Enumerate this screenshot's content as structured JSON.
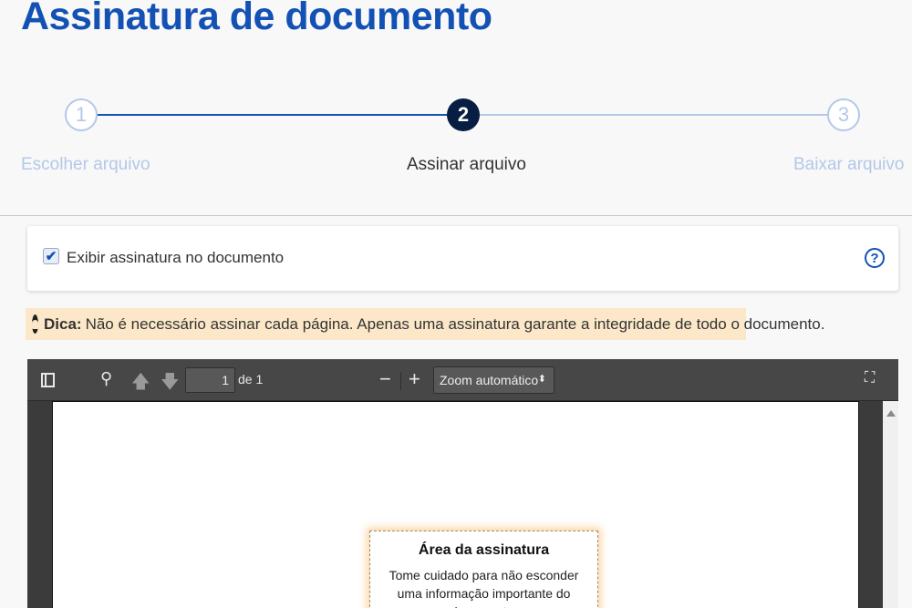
{
  "page": {
    "title": "Assinatura de documento"
  },
  "steps": [
    {
      "number": "1",
      "label": "Escolher arquivo",
      "state": "done"
    },
    {
      "number": "2",
      "label": "Assinar arquivo",
      "state": "active"
    },
    {
      "number": "3",
      "label": "Baixar arquivo",
      "state": "pending"
    }
  ],
  "options": {
    "show_signature_label": "Exibir assinatura no documento",
    "show_signature_checked": true,
    "help_icon": "question-circle-icon",
    "help_glyph": "?"
  },
  "tip": {
    "icon": "lightbulb-icon",
    "label": "Dica:",
    "text": "Não é necessário assinar cada página. Apenas uma assinatura garante a integridade de todo o documento."
  },
  "viewer": {
    "page_number": "1",
    "page_total_text": "de 1",
    "zoom_label": "Zoom automático",
    "zoom_minus": "−",
    "zoom_plus": "+"
  },
  "signature_area": {
    "title": "Área da assinatura",
    "text": "Tome cuidado para não esconder uma informação importante do documento."
  },
  "colors": {
    "primary": "#1351b4",
    "active_step": "#071d41",
    "inactive_step": "#b3c8e8",
    "tip_background": "#fce8c8"
  }
}
